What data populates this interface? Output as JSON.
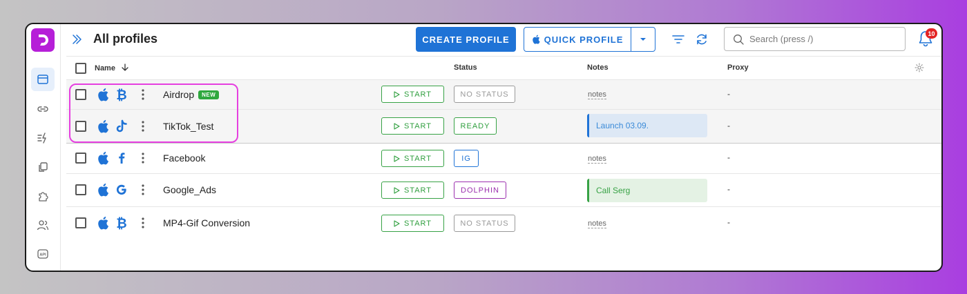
{
  "header": {
    "title": "All profiles",
    "create_label": "CREATE PROFILE",
    "quick_label": "QUICK PROFILE",
    "search_placeholder": "Search (press /)",
    "notifications_count": "10"
  },
  "table": {
    "columns": {
      "name": "Name",
      "status": "Status",
      "notes": "Notes",
      "proxy": "Proxy"
    },
    "start_label": "START",
    "rows": [
      {
        "os_icon": "apple-icon",
        "site_icon": "bitcoin-icon",
        "name": "Airdrop",
        "badge": "NEW",
        "status": "NO STATUS",
        "notes": "notes",
        "proxy": "-"
      },
      {
        "os_icon": "apple-icon",
        "site_icon": "tiktok-icon",
        "name": "TikTok_Test",
        "badge": "",
        "status": "READY",
        "notes": "Launch 03.09.",
        "proxy": "-"
      },
      {
        "os_icon": "apple-icon",
        "site_icon": "facebook-icon",
        "name": "Facebook",
        "badge": "",
        "status": "IG",
        "notes": "notes",
        "proxy": "-"
      },
      {
        "os_icon": "apple-icon",
        "site_icon": "google-icon",
        "name": "Google_Ads",
        "badge": "",
        "status": "DOLPHIN",
        "notes": "Call Serg",
        "proxy": "-"
      },
      {
        "os_icon": "apple-icon",
        "site_icon": "bitcoin-icon",
        "name": "MP4-Gif Conversion",
        "badge": "",
        "status": "NO STATUS",
        "notes": "notes",
        "proxy": "-"
      }
    ]
  },
  "colors": {
    "primary": "#1f73d6",
    "start_green": "#2e9e3d",
    "highlight": "#e63fe0",
    "brand": "#b61fd8",
    "status_gray": "#999999",
    "status_blue": "#1f73d6",
    "status_purple": "#9b2fae"
  }
}
